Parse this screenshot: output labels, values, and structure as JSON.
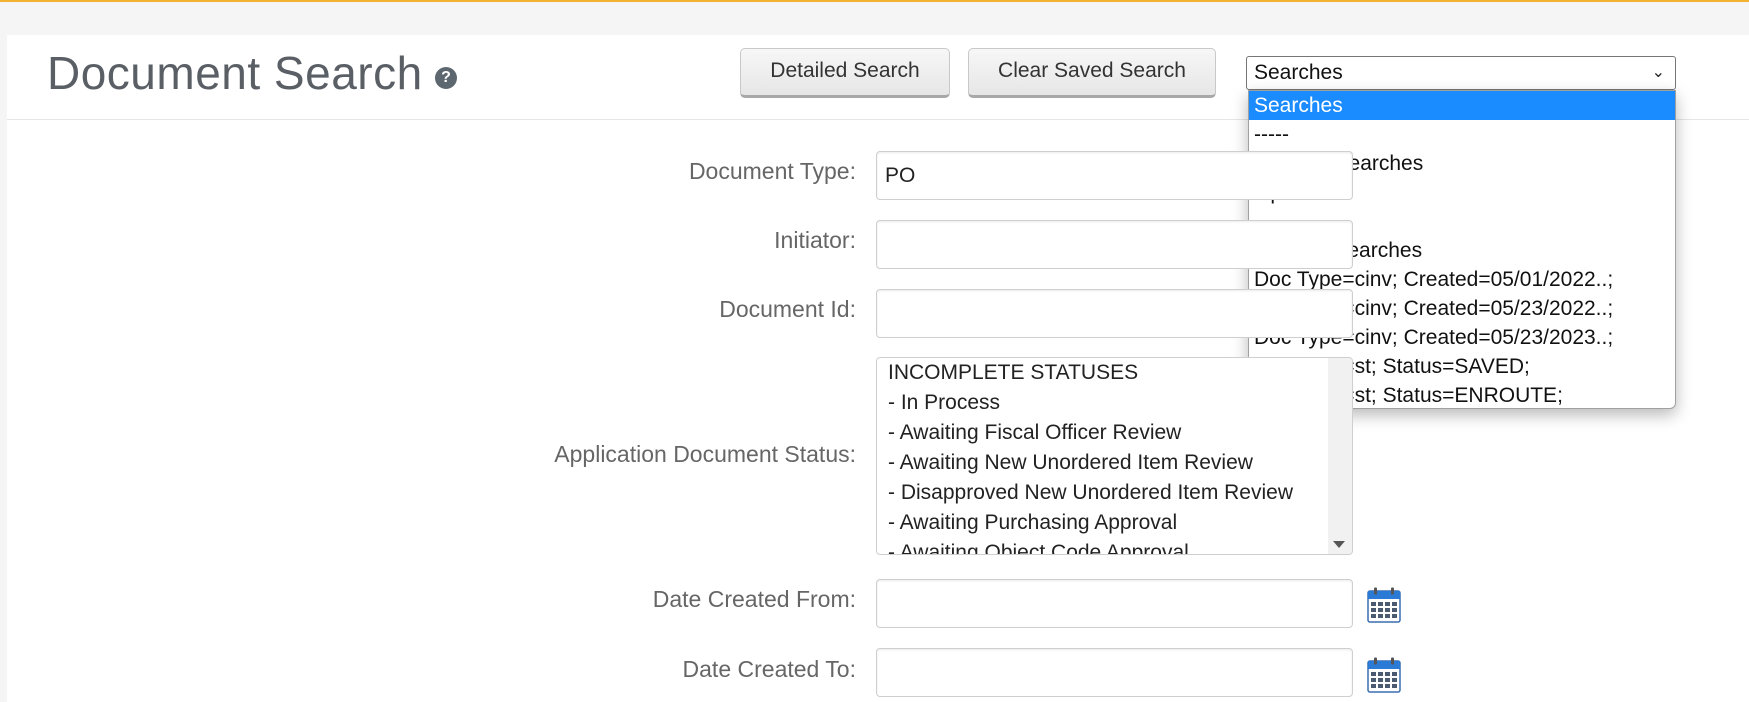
{
  "header": {
    "title": "Document Search",
    "help_icon": "question-circle-icon",
    "buttons": {
      "detailed_search": "Detailed Search",
      "clear_saved_search": "Clear Saved Search"
    },
    "saved_searches_select": {
      "value": "Searches",
      "options": [
        "Searches",
        "-----",
        "-Named Searches",
        "Open POs",
        "-----",
        "-Recent Searches",
        "Doc Type=cinv; Created=05/01/2022..;",
        "Doc Type=cinv; Created=05/23/2022..;",
        "Doc Type=cinv; Created=05/23/2023..;",
        "Doc Type=st; Status=SAVED;",
        "Doc Type=st; Status=ENROUTE;"
      ],
      "selected_index": 0
    }
  },
  "form": {
    "document_type": {
      "label": "Document Type:",
      "value": "PO"
    },
    "initiator": {
      "label": "Initiator:",
      "value": ""
    },
    "document_id": {
      "label": "Document Id:",
      "value": ""
    },
    "application_document_status": {
      "label": "Application Document Status:",
      "options": [
        "INCOMPLETE STATUSES",
        "- In Process",
        "- Awaiting Fiscal Officer Review",
        "- Awaiting New Unordered Item Review",
        "- Disapproved New Unordered Item Review",
        "- Awaiting Purchasing Approval",
        "- Awaiting Object Code Approval"
      ]
    },
    "date_created_from": {
      "label": "Date Created From:",
      "value": "",
      "icon": "calendar-icon"
    },
    "date_created_to": {
      "label": "Date Created To:",
      "value": "",
      "icon": "calendar-icon"
    }
  },
  "colors": {
    "accent_top_border": "#f2b233",
    "dropdown_highlight": "#1a8cff",
    "calendar_blue": "#2a7ad6"
  }
}
